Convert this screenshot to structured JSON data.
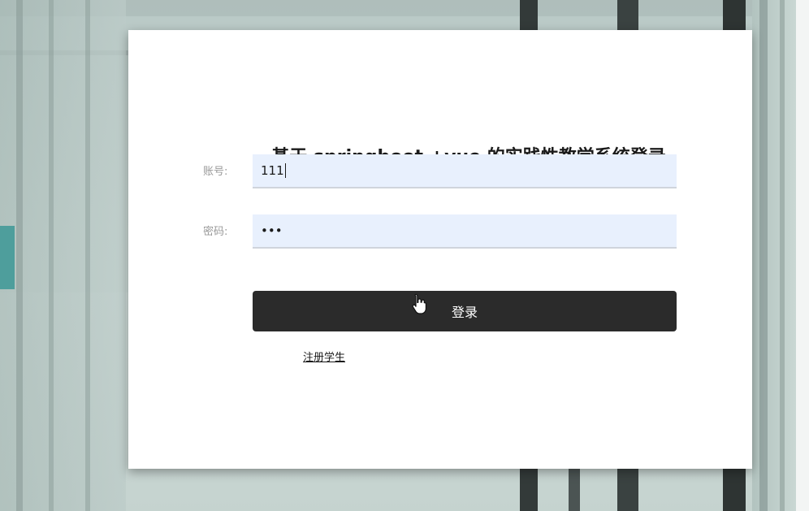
{
  "window": {
    "title": "基于 springboot +vue 的实践性教学系统登录"
  },
  "form": {
    "account": {
      "label": "账号:",
      "value": "111"
    },
    "password": {
      "label": "密码:",
      "masked_value": "•••"
    },
    "login_button_label": "登录",
    "register_link_label": "注册学生"
  },
  "icons": {
    "cursor": "hand-pointer-icon"
  },
  "colors": {
    "login_button_bg": "#2b2b2b",
    "input_bg": "#e8f0fd",
    "label_color": "#999999",
    "card_bg": "#ffffff"
  }
}
